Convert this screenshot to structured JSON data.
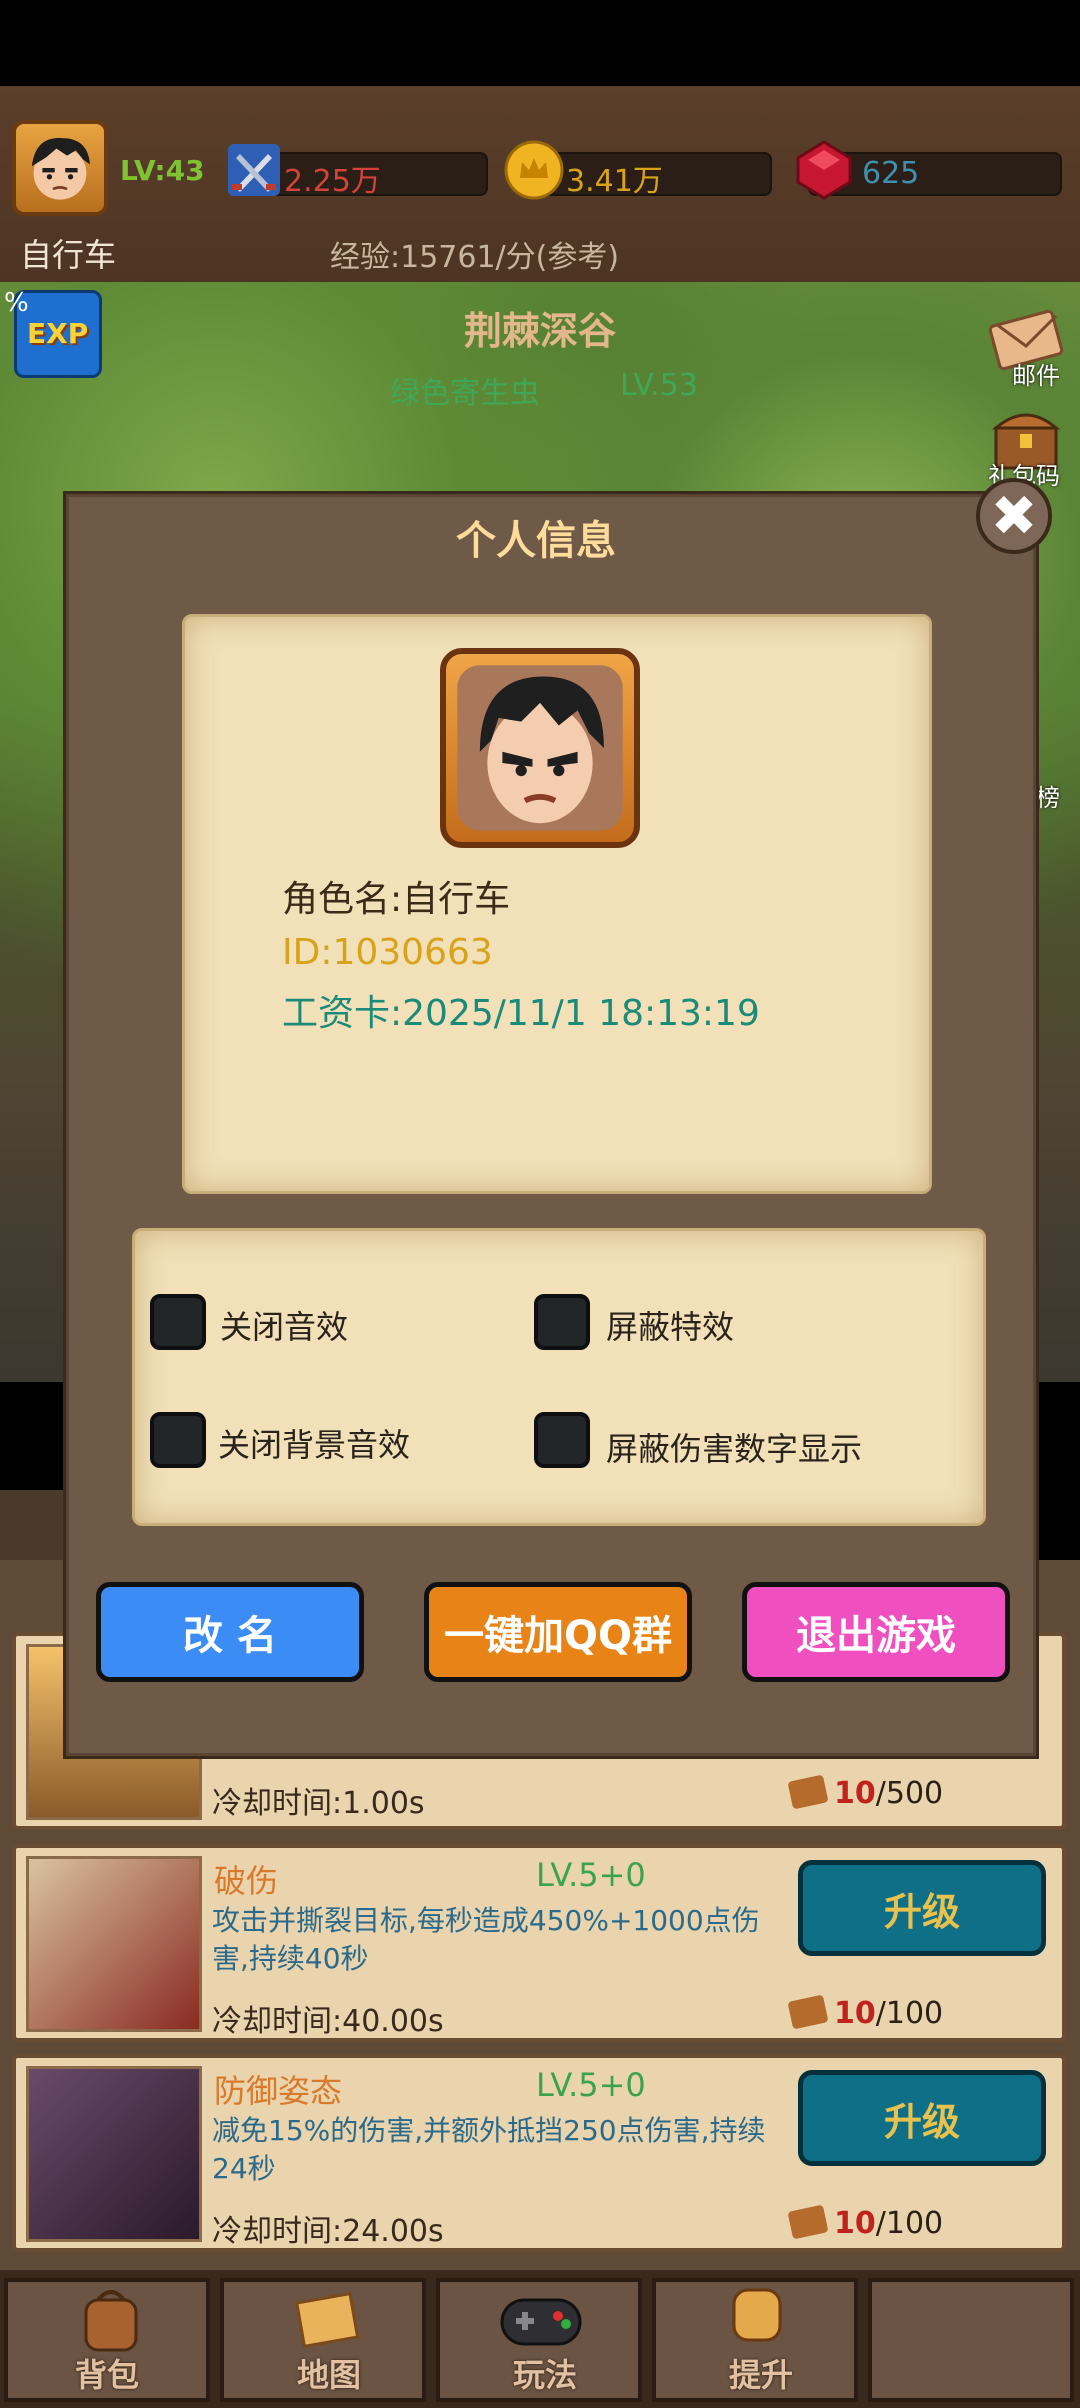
{
  "hud": {
    "level": "LV:43",
    "attack": "2.25万",
    "gold": "3.41万",
    "gems": "625",
    "player_name": "自行车",
    "exp_rate": "经验:15761/分(参考)",
    "exp_percent": "%",
    "exp_badge": "EXP"
  },
  "scene": {
    "map_name": "荆棘深谷",
    "monster_name": "绿色寄生虫",
    "monster_level": "LV.53",
    "side_mail": "邮件",
    "side_gift": "礼包码",
    "side_rank": "榜"
  },
  "modal": {
    "title": "个人信息",
    "close": "✖",
    "role_name": "角色名:自行车",
    "id": "ID:1030663",
    "salary_card": "工资卡:2025/11/1 18:13:19",
    "settings": [
      {
        "label": "关闭音效"
      },
      {
        "label": "屏蔽特效"
      },
      {
        "label": "关闭背景音效"
      },
      {
        "label": "屏蔽伤害数字显示"
      }
    ],
    "rename_button": "改 名",
    "qq_button": "一键加QQ群",
    "exit_button": "退出游戏"
  },
  "skills": [
    {
      "name": "",
      "level": "",
      "desc": "",
      "cooldown": "冷却时间:1.00s",
      "cost_have": "10",
      "cost_need": "/500"
    },
    {
      "name": "破伤",
      "level": "LV.5+0",
      "desc": "攻击并撕裂目标,每秒造成450%+1000点伤害,持续40秒",
      "cooldown": "冷却时间:40.00s",
      "upgrade": "升级",
      "cost_have": "10",
      "cost_need": "/100"
    },
    {
      "name": "防御姿态",
      "level": "LV.5+0",
      "desc": "减免15%的伤害,并额外抵挡250点伤害,持续24秒",
      "cooldown": "冷却时间:24.00s",
      "upgrade": "升级",
      "cost_have": "10",
      "cost_need": "/100"
    }
  ],
  "nav": [
    {
      "label": "背包"
    },
    {
      "label": "地图"
    },
    {
      "label": "玩法"
    },
    {
      "label": "提升"
    },
    {
      "label": ""
    }
  ],
  "colors": {
    "rename_button": "#3b8cf5",
    "qq_button": "#e88417",
    "exit_button": "#f04fc0",
    "modal_bg": "#6f5a48",
    "parchment": "#f1e0b8",
    "gold_text": "#d8a31a",
    "teal_text": "#1b8a78"
  },
  "icons": {
    "attack": "crossed-swords-icon",
    "gold": "crown-coin-icon",
    "gems": "ruby-icon",
    "close": "close-icon"
  }
}
